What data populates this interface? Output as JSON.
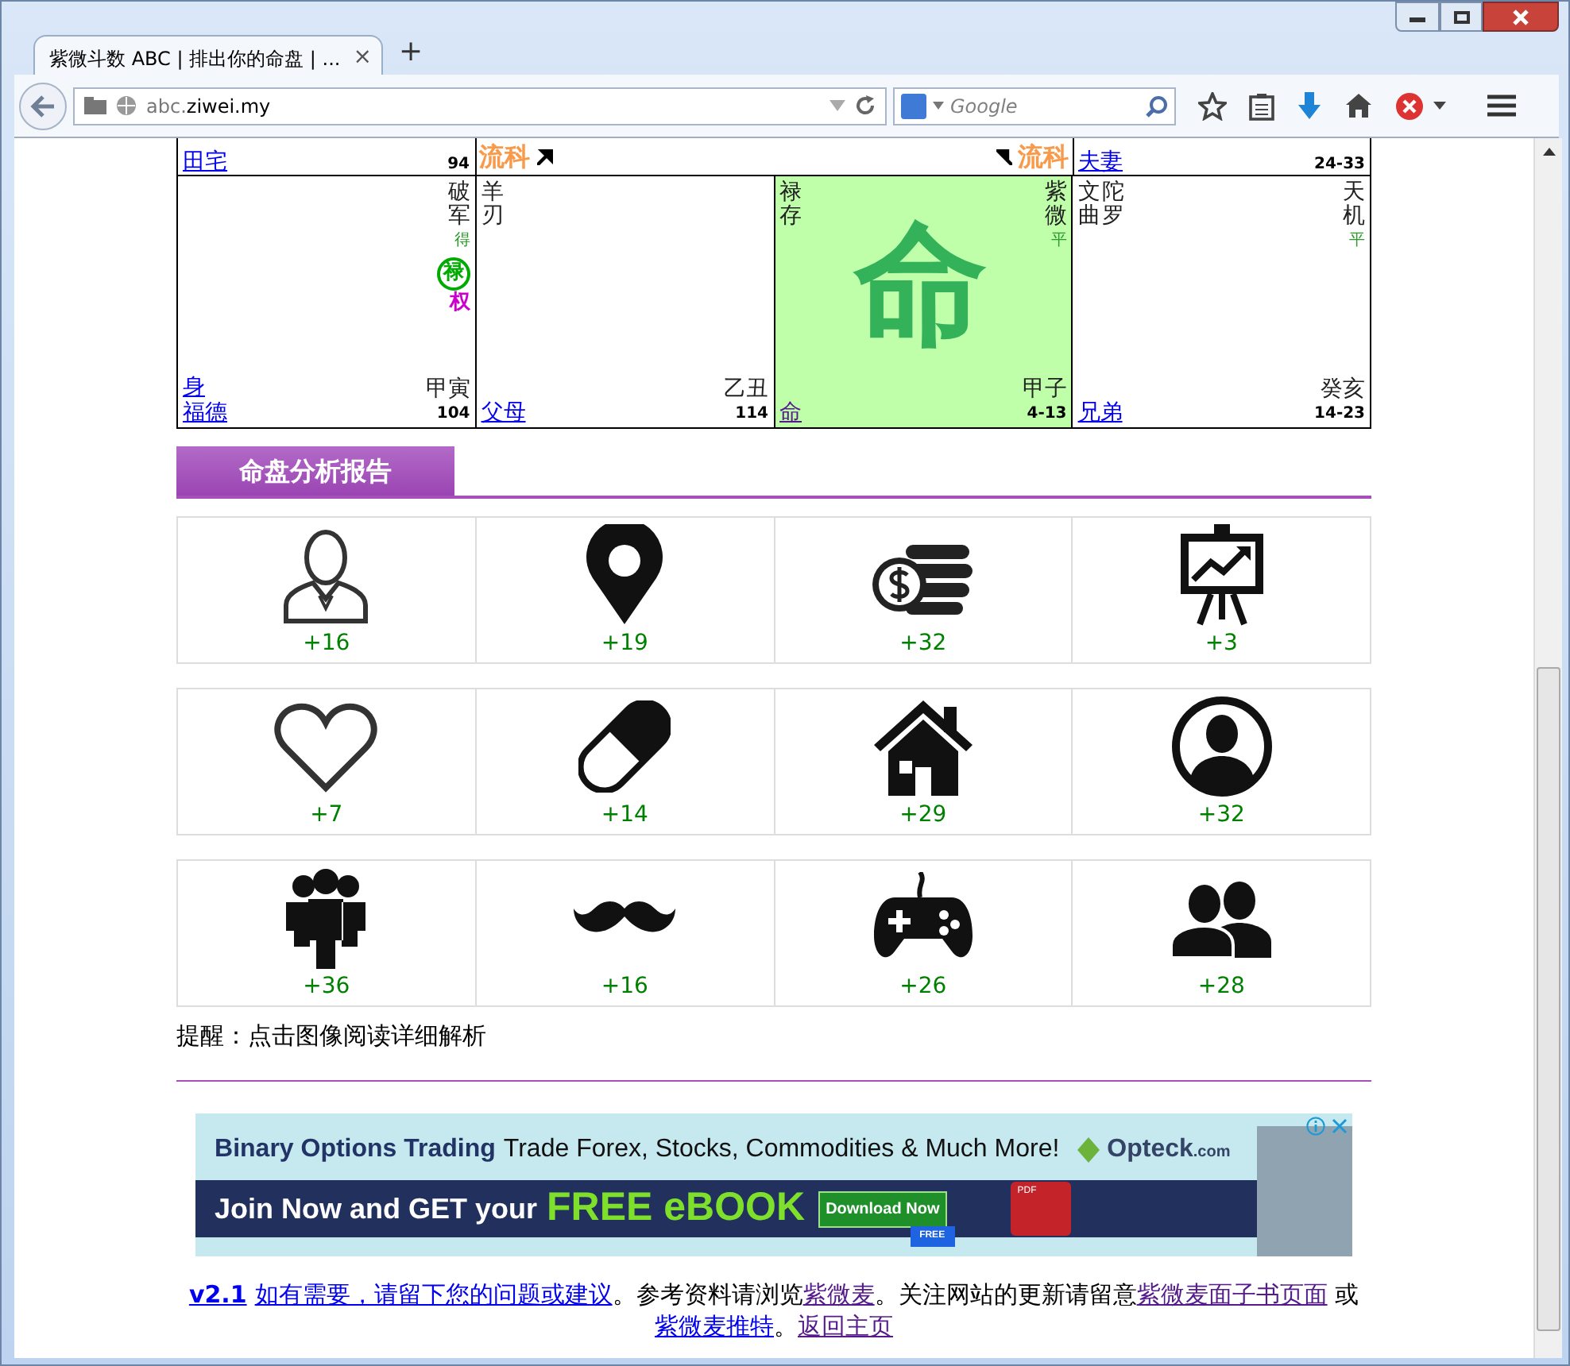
{
  "browser": {
    "tab_title": "紫微斗数 ABC | 排出你的命盘 | ...",
    "tab_close": "×",
    "new_tab": "+",
    "url_host": "abc.",
    "url_domain": "ziwei.my",
    "search_placeholder": "Google"
  },
  "chart": {
    "top_row": {
      "left": {
        "palace": "田宅",
        "age": "94"
      },
      "liuke_left": "流科",
      "liuke_right": "流科",
      "right": {
        "palace": "夫妻",
        "age": "24-33"
      }
    },
    "cells": [
      {
        "highlighted": false,
        "stars_right": [
          {
            "name": "破军",
            "brightness": "得"
          }
        ],
        "transforms": [
          {
            "label": "禄",
            "circled": true,
            "color": "#00aa00"
          },
          {
            "label": "权",
            "circled": false,
            "color": "#cc00cc"
          }
        ],
        "body": "身",
        "stem": "甲寅",
        "palace": "福德",
        "palace_visited": false,
        "age": "104"
      },
      {
        "highlighted": false,
        "stars_left": [
          {
            "name": "羊刃"
          }
        ],
        "stem": "乙丑",
        "palace": "父母",
        "palace_visited": false,
        "age": "114"
      },
      {
        "highlighted": true,
        "stars_left": [
          {
            "name": "禄存"
          }
        ],
        "stars_right": [
          {
            "name": "紫微",
            "brightness": "平"
          }
        ],
        "big": "命",
        "stem": "甲子",
        "palace": "命",
        "palace_visited": true,
        "age": "4-13"
      },
      {
        "highlighted": false,
        "stars_left": [
          {
            "name": "文曲"
          },
          {
            "name": "陀罗"
          }
        ],
        "stars_right": [
          {
            "name": "天机",
            "brightness": "平"
          }
        ],
        "stem": "癸亥",
        "palace": "兄弟",
        "palace_visited": false,
        "age": "14-23"
      }
    ]
  },
  "report": {
    "title": "命盘分析报告",
    "items": [
      {
        "score": "+16"
      },
      {
        "score": "+19"
      },
      {
        "score": "+32"
      },
      {
        "score": "+3"
      },
      {
        "score": "+7"
      },
      {
        "score": "+14"
      },
      {
        "score": "+29"
      },
      {
        "score": "+32"
      },
      {
        "score": "+36"
      },
      {
        "score": "+16"
      },
      {
        "score": "+26"
      },
      {
        "score": "+28"
      }
    ],
    "reminder": "提醒：点击图像阅读详细解析"
  },
  "ad": {
    "headline_bold": "Binary Options Trading",
    "headline": "Trade Forex, Stocks, Commodities & Much More!",
    "brand": "Opteck",
    "brand_suffix": ".com",
    "cta": "Join Now and GET your",
    "cta_highlight": "FREE eBOOK",
    "button": "Download Now",
    "free_tag": "FREE",
    "pdf_label": "PDF"
  },
  "footer": [
    {
      "kind": "version",
      "text": "v2.1",
      "visited": false
    },
    {
      "kind": "link",
      "text": "如有需要，请留下您的问题或建议",
      "visited": false
    },
    {
      "kind": "text",
      "text": "。参考资料请浏览"
    },
    {
      "kind": "link",
      "text": "紫微麦",
      "visited": true
    },
    {
      "kind": "text",
      "text": "。关注网站的更新请留意"
    },
    {
      "kind": "link",
      "text": "紫微麦面子书页面",
      "visited": true
    },
    {
      "kind": "text",
      "text": " 或"
    },
    {
      "kind": "link",
      "text": "紫微麦推特",
      "visited": false
    },
    {
      "kind": "text",
      "text": "。"
    },
    {
      "kind": "link",
      "text": "返回主页",
      "visited": true
    }
  ]
}
